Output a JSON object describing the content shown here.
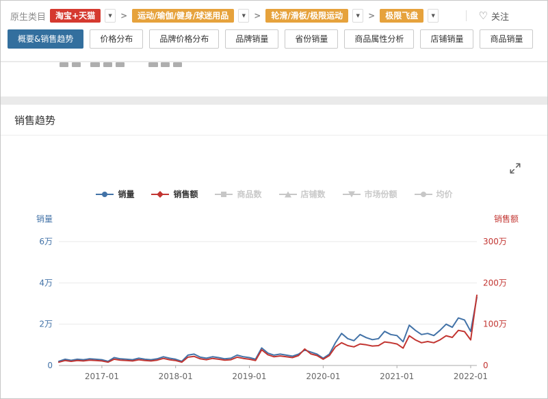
{
  "icons": {
    "caret": "▼",
    "heart": "♡"
  },
  "breadcrumb": {
    "label": "原生类目",
    "separator": ">",
    "items": [
      {
        "label": "淘宝+天猫",
        "color": "#d5392f"
      },
      {
        "label": "运动/瑜伽/健身/球迷用品",
        "color": "#e6a23c"
      },
      {
        "label": "轮滑/滑板/极限运动",
        "color": "#e6a23c"
      },
      {
        "label": "极限飞盘",
        "color": "#e6a23c"
      }
    ],
    "follow_label": "关注"
  },
  "tabs": [
    {
      "label": "概要&销售趋势",
      "active": true
    },
    {
      "label": "价格分布",
      "active": false
    },
    {
      "label": "品牌价格分布",
      "active": false
    },
    {
      "label": "品牌销量",
      "active": false
    },
    {
      "label": "省份销量",
      "active": false
    },
    {
      "label": "商品属性分析",
      "active": false
    },
    {
      "label": "店铺销量",
      "active": false
    },
    {
      "label": "商品销量",
      "active": false
    }
  ],
  "panel": {
    "title": "销售趋势"
  },
  "chart_data": {
    "type": "line",
    "title": "销售趋势",
    "disabled_color": "#c7c7c7",
    "legend": [
      {
        "label": "销量",
        "color": "#4272a7",
        "enabled": true
      },
      {
        "label": "销售额",
        "color": "#c23531",
        "enabled": true
      },
      {
        "label": "商品数",
        "color": "#c7c7c7",
        "enabled": false
      },
      {
        "label": "店铺数",
        "color": "#c7c7c7",
        "enabled": false
      },
      {
        "label": "市场份额",
        "color": "#c7c7c7",
        "enabled": false
      },
      {
        "label": "均价",
        "color": "#c7c7c7",
        "enabled": false
      }
    ],
    "y_left": {
      "name": "销量",
      "color": "#4272a7",
      "unit": "万",
      "max": 6,
      "ticks": [
        "6万",
        "4万",
        "2万",
        "0"
      ]
    },
    "y_right": {
      "name": "销售额",
      "color": "#c23531",
      "unit": "万",
      "max": 300,
      "ticks": [
        "300万",
        "200万",
        "100万",
        "0"
      ]
    },
    "x_labels": [
      "2017-01",
      "2018-01",
      "2019-01",
      "2020-01",
      "2021-01",
      "2022-01"
    ],
    "x": [
      "2016-06",
      "2016-07",
      "2016-08",
      "2016-09",
      "2016-10",
      "2016-11",
      "2016-12",
      "2017-01",
      "2017-02",
      "2017-03",
      "2017-04",
      "2017-05",
      "2017-06",
      "2017-07",
      "2017-08",
      "2017-09",
      "2017-10",
      "2017-11",
      "2017-12",
      "2018-01",
      "2018-02",
      "2018-03",
      "2018-04",
      "2018-05",
      "2018-06",
      "2018-07",
      "2018-08",
      "2018-09",
      "2018-10",
      "2018-11",
      "2018-12",
      "2019-01",
      "2019-02",
      "2019-03",
      "2019-04",
      "2019-05",
      "2019-06",
      "2019-07",
      "2019-08",
      "2019-09",
      "2019-10",
      "2019-11",
      "2019-12",
      "2020-01",
      "2020-02",
      "2020-03",
      "2020-04",
      "2020-05",
      "2020-06",
      "2020-07",
      "2020-08",
      "2020-09",
      "2020-10",
      "2020-11",
      "2020-12",
      "2021-01",
      "2021-02",
      "2021-03",
      "2021-04",
      "2021-05",
      "2021-06",
      "2021-07",
      "2021-08",
      "2021-09",
      "2021-10",
      "2021-11",
      "2021-12",
      "2022-01",
      "2022-02"
    ],
    "series": [
      {
        "name": "销量",
        "axis": "left",
        "color": "#4272a7",
        "values": [
          0.2,
          0.3,
          0.25,
          0.3,
          0.28,
          0.32,
          0.3,
          0.28,
          0.2,
          0.38,
          0.32,
          0.3,
          0.28,
          0.35,
          0.3,
          0.28,
          0.32,
          0.42,
          0.35,
          0.3,
          0.2,
          0.5,
          0.55,
          0.4,
          0.35,
          0.42,
          0.38,
          0.32,
          0.35,
          0.5,
          0.42,
          0.38,
          0.3,
          0.85,
          0.6,
          0.5,
          0.55,
          0.5,
          0.45,
          0.55,
          0.75,
          0.65,
          0.55,
          0.35,
          0.55,
          1.1,
          1.55,
          1.3,
          1.2,
          1.5,
          1.35,
          1.25,
          1.3,
          1.65,
          1.5,
          1.45,
          1.15,
          1.95,
          1.7,
          1.5,
          1.55,
          1.45,
          1.7,
          2.0,
          1.85,
          2.3,
          2.2,
          1.65,
          3.3
        ]
      },
      {
        "name": "销售额",
        "axis": "right",
        "color": "#c23531",
        "values": [
          8,
          12,
          10,
          12,
          11,
          13,
          12,
          11,
          8,
          15,
          13,
          12,
          11,
          14,
          12,
          11,
          13,
          17,
          14,
          12,
          8,
          20,
          22,
          16,
          14,
          17,
          15,
          13,
          14,
          20,
          17,
          15,
          12,
          38,
          26,
          21,
          23,
          21,
          19,
          24,
          40,
          28,
          24,
          15,
          24,
          45,
          55,
          48,
          45,
          52,
          50,
          47,
          48,
          57,
          55,
          52,
          42,
          72,
          62,
          55,
          58,
          55,
          62,
          72,
          68,
          85,
          82,
          62,
          170
        ]
      }
    ]
  }
}
